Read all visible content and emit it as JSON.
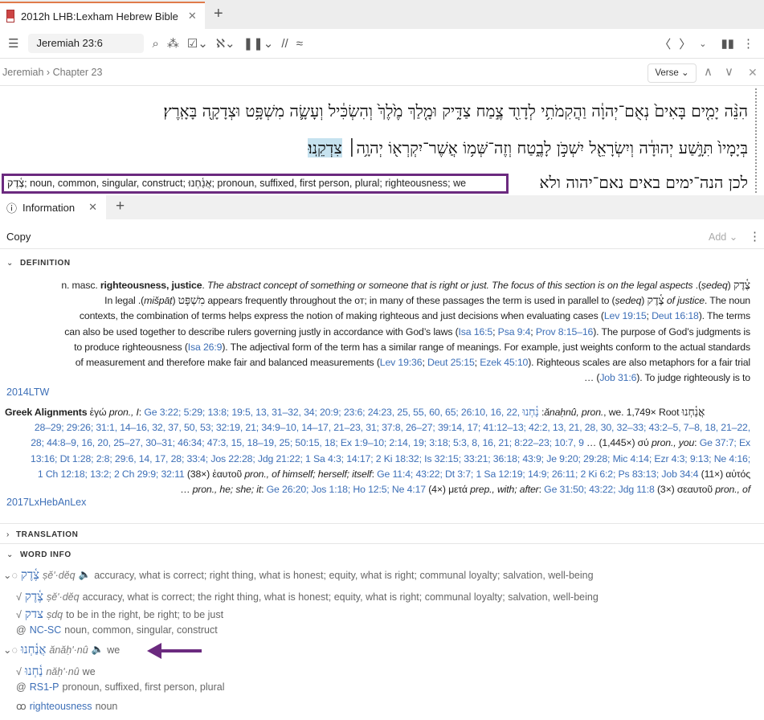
{
  "tab": {
    "title": "2012h LHB:Lexham Hebrew Bible",
    "close": "✕",
    "new": "+"
  },
  "toolbar": {
    "reference": "Jeremiah 23:6",
    "menu": "☰",
    "icons": [
      "search-icon",
      "visual-filter-icon",
      "checkbox-icon",
      "interlinear-icon",
      "columns-icon",
      "parallel-icon",
      "approx-icon"
    ],
    "back": "〈",
    "forward": "〉",
    "more": "⋮"
  },
  "breadcrumb": {
    "book": "Jeremiah",
    "sep": "›",
    "chapter": "Chapter 23",
    "verse_btn": "Verse ⌄"
  },
  "hebrew": {
    "line1": "הִנֵּ֨ה יָמִ֤ים בָּאִים֙ נְאֻם־יְהוָ֔ה וַהֲקִמֹתִ֥י לְדָוִ֖ד צֶ֣מַח צַדִּ֑יק וּמָ֤לַךְ מֶ֙לֶךְ֙ וְהִשְׂכִּ֔יל וְעָשָׂ֛ה מִשְׁפָּ֥ט וּצְדָקָ֖ה בָּאָֽרֶץ׃",
    "line2_a": "בְּיָמָיו֙ תִּוָּ֣שַׁע יְהוּדָ֔ה וְיִשְׂרָאֵ֖ל יִשְׁכֹּ֣ן לָבֶ֑טַח וְזֶה־שְּׁמ֥וֹ אֲשֶׁר־יִקְרְא֖וֹ יְהוָ֥ה׀",
    "line2_hl": "צִדְקֵֽנוּ׃",
    "line3": "לכן הנה־ימים באים נאם־יהוה ולא"
  },
  "tooltip": "צֶ֫דֶק; noun, common, singular, construct; אֲנַ֫חְנוּ; pronoun, suffixed, first person, plural; righteousness; we",
  "info": {
    "tab": "Information",
    "close": "✕",
    "new": "+",
    "copy": "Copy",
    "add": "Add ⌄",
    "more": "⋮"
  },
  "sections": {
    "definition": "DEFINITION",
    "translation": "TRANSLATION",
    "word_info": "WORD INFO",
    "open": "⌄",
    "closed": "›"
  },
  "definition": [
    [
      {
        "t": "n. masc. "
      },
      {
        "t": "righteousness, justice",
        "s": "b"
      },
      {
        "t": ". "
      },
      {
        "t": "The abstract concept of something or someone that is right or just. The focus of this section is on the legal aspects",
        "s": "i"
      },
      {
        "t": " .("
      },
      {
        "t": "ṣedeq",
        "s": "i"
      },
      {
        "t": ") "
      },
      {
        "t": "צֶ֫דֶק",
        "s": "h"
      }
    ],
    [
      {
        "t": "In legal .("
      },
      {
        "t": "mišpāṭ",
        "s": "i"
      },
      {
        "t": ") "
      },
      {
        "t": "מִשְׁפָּט",
        "s": "h"
      },
      {
        "t": " appears frequently throughout the ᴏᴛ; in many of these passages the term is used in parallel to ("
      },
      {
        "t": "ṣedeq",
        "s": "i"
      },
      {
        "t": ") "
      },
      {
        "t": "צֶ֫דֶק",
        "s": "h"
      },
      {
        "t": " of justice",
        "s": "i"
      },
      {
        "t": ". The noun"
      }
    ],
    [
      {
        "t": "contexts, the combination of terms helps express the notion of making righteous and just decisions when evaluating cases ("
      },
      {
        "t": "Lev 19:15",
        "s": "l"
      },
      {
        "t": "; "
      },
      {
        "t": "Deut 16:18",
        "s": "l"
      },
      {
        "t": "). The terms"
      }
    ],
    [
      {
        "t": "can also be used together to describe rulers governing justly in accordance with God’s laws ("
      },
      {
        "t": "Isa 16:5",
        "s": "l"
      },
      {
        "t": "; "
      },
      {
        "t": "Psa 9:4",
        "s": "l"
      },
      {
        "t": "; "
      },
      {
        "t": "Prov 8:15–16",
        "s": "l"
      },
      {
        "t": "). The purpose of God’s judgments is"
      }
    ],
    [
      {
        "t": "to produce righteousness ("
      },
      {
        "t": "Isa 26:9",
        "s": "l"
      },
      {
        "t": "). The adjectival form of the term has a similar range of meanings. For example, just weights conform to the actual standards"
      }
    ],
    [
      {
        "t": "of measurement and therefore make fair and balanced measurements ("
      },
      {
        "t": "Lev 19:36",
        "s": "l"
      },
      {
        "t": "; "
      },
      {
        "t": "Deut 25:15",
        "s": "l"
      },
      {
        "t": "; "
      },
      {
        "t": "Ezek 45:10",
        "s": "l"
      },
      {
        "t": "). Righteous scales are also metaphors for a fair trial"
      }
    ],
    [
      {
        "t": "… ("
      },
      {
        "t": "Job 31:6",
        "s": "l"
      },
      {
        "t": "). To judge righteously is to"
      }
    ]
  ],
  "definition_source": "2014LTW",
  "greek": [
    [
      {
        "t": "Greek Alignments ",
        "s": "b"
      },
      {
        "t": "ἐγώ "
      },
      {
        "t": "pron., I",
        "s": "i"
      },
      {
        "t": ": "
      },
      {
        "t": "Ge 3:22; 5:29; 13:8; 19:5, 13, 31–32, 34; 20:9; 23:6; 24:23, 25, 55, 60, 65; 26:10, 16, 22, ",
        "s": "l"
      },
      {
        "t": "נַ֫חְנוּ",
        "s": "hl"
      },
      {
        "t": " :"
      },
      {
        "t": "ănaḥnû, pron.",
        "s": "i"
      },
      {
        "t": ", we. 1,749× Root "
      },
      {
        "t": "אֲנַ֫חְנוּ",
        "s": "h"
      }
    ],
    [
      {
        "t": "28–29; 29:26; 31:1, 14–16, 32, 37, 50, 53; 32:19, 21; 34:9–10, 14–17, 21–23, 31; 37:8, 26–27; 39:14, 17; 41:12–13; 42:2, 13, 21, 28, 30, 32–33; 43:2–5, 7–8, 18, 21–22,",
        "s": "l"
      }
    ],
    [
      {
        "t": "28; 44:8–9, 16, 20, 25–27, 30–31; 46:34; 47:3, 15, 18–19, 25; 50:15, 18; Ex 1:9–10; 2:14, 19; 3:18; 5:3, 8, 16, 21; 8:22–23; 10:7, 9",
        "s": "l"
      },
      {
        "t": " … (1,445×) σύ "
      },
      {
        "t": "pron., you",
        "s": "i"
      },
      {
        "t": ": "
      },
      {
        "t": "Ge 37:7; Ex",
        "s": "l"
      }
    ],
    [
      {
        "t": "13:16; Dt 1:28; 2:8; 29:6, 14, 17, 28; 33:4; Jos 22:28; Jdg 21:22; 1 Sa 4:3; 14:17; 2 Ki 18:32; Is 32:15; 33:21; 36:18; 43:9; Je 9:20; 29:28; Mic 4:14; Ezr 4:3; 9:13; Ne 4:16;",
        "s": "l"
      }
    ],
    [
      {
        "t": "1 Ch 12:18; 13:2; 2 Ch 29:9; 32:11",
        "s": "l"
      },
      {
        "t": " (38×) ἑαυτοῦ "
      },
      {
        "t": "pron., of himself; herself; itself",
        "s": "i"
      },
      {
        "t": ": "
      },
      {
        "t": "Ge 11:4; 43:22; Dt 3:7; 1 Sa 12:19; 14:9; 26:11; 2 Ki 6:2; Ps 83:13; Job 34:4",
        "s": "l"
      },
      {
        "t": " (11×) αὐτός"
      }
    ],
    [
      {
        "t": "… "
      },
      {
        "t": "pron., he; she; it",
        "s": "i"
      },
      {
        "t": ": "
      },
      {
        "t": "Ge 26:20; Jos 1:18; Ho 12:5; Ne 4:17",
        "s": "l"
      },
      {
        "t": " (4×) μετά "
      },
      {
        "t": "prep., with; after",
        "s": "i"
      },
      {
        "t": ": "
      },
      {
        "t": "Ge 31:50; 43:22; Jdg 11:8",
        "s": "l"
      },
      {
        "t": " (3×) σεαυτοῦ "
      },
      {
        "t": "pron., of",
        "s": "i"
      }
    ]
  ],
  "greek_source": "2017LxHebAnLex",
  "word_info": [
    {
      "lead": "⌄◌",
      "heb": "צֶ֫דֶק",
      "translit": "ṣĕʹ·dĕq",
      "audio": "🔈",
      "gloss": "accuracy, what is correct; right thing, what is honest; equity, what is right; communal loyalty; salvation, well-being"
    },
    {
      "lead": "√",
      "heb": "צֶ֫דֶק",
      "translit": "ṣĕʹ·dĕq",
      "gloss": "accuracy, what is correct; the right thing, what is honest; equity, what is right; communal loyalty; salvation, well-being"
    },
    {
      "lead": "√",
      "heb": "צדק",
      "translit": "ṣdq",
      "gloss": "to be in the right, be right; to be just"
    },
    {
      "lead": "@",
      "code": "NC-SC",
      "gloss": "noun, common, singular, construct"
    },
    {
      "lead": "⌄◌",
      "heb": "אֲנַ֫חְנוּ",
      "translit": "ănăḥʹ·nû",
      "audio": "🔈",
      "gloss": "we"
    },
    {
      "lead": "√",
      "heb": "נַ֫חְנוּ",
      "translit": "năḥʹ·nû",
      "gloss": "we"
    },
    {
      "lead": "@",
      "code": "RS1-P",
      "gloss": "pronoun, suffixed, first person, plural"
    },
    {
      "lead": "ꝏ",
      "code": "righteousness",
      "gloss": "noun"
    }
  ],
  "colors": {
    "accent": "#3d6fb7",
    "highlight": "#c6e2ef",
    "annotation": "#6b2a7f",
    "tab_accent": "#e07b4a"
  }
}
